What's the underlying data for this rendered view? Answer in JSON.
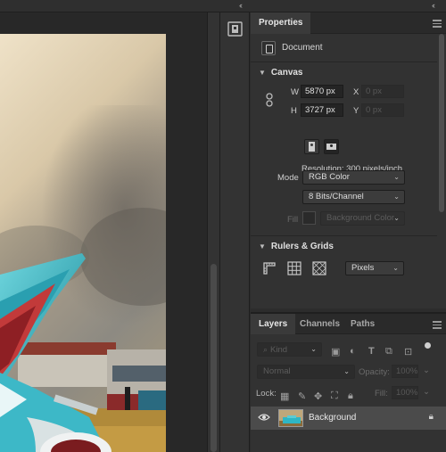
{
  "topbar": {
    "collapse_left": "‹‹",
    "collapse_right": "‹‹"
  },
  "properties": {
    "tabs": [
      {
        "label": "Properties",
        "active": true
      }
    ],
    "document_label": "Document",
    "canvas": {
      "title": "Canvas",
      "width_label": "W",
      "width_value": "5870 px",
      "height_label": "H",
      "height_value": "3727 px",
      "x_label": "X",
      "x_placeholder": "0 px",
      "y_label": "Y",
      "y_placeholder": "0 px",
      "resolution": "Resolution: 300 pixels/inch",
      "mode_label": "Mode",
      "mode_value": "RGB Color",
      "depth_value": "8 Bits/Channel",
      "fill_label": "Fill",
      "fill_value": "Background Color"
    },
    "rulers": {
      "title": "Rulers & Grids",
      "units_value": "Pixels"
    }
  },
  "layers": {
    "tabs": [
      {
        "label": "Layers",
        "active": true
      },
      {
        "label": "Channels",
        "active": false
      },
      {
        "label": "Paths",
        "active": false
      }
    ],
    "filter_kind": "Kind",
    "blend_mode": "Normal",
    "opacity_label": "Opacity:",
    "opacity_value": "100%",
    "lock_label": "Lock:",
    "fill_label": "Fill:",
    "fill_value": "100%",
    "items": [
      {
        "name": "Background",
        "visible": true,
        "locked": true
      }
    ]
  },
  "colors": {
    "panel_bg": "#323232",
    "selected_layer": "#4b4b4b",
    "accent_teal": "#2fb6c4"
  }
}
